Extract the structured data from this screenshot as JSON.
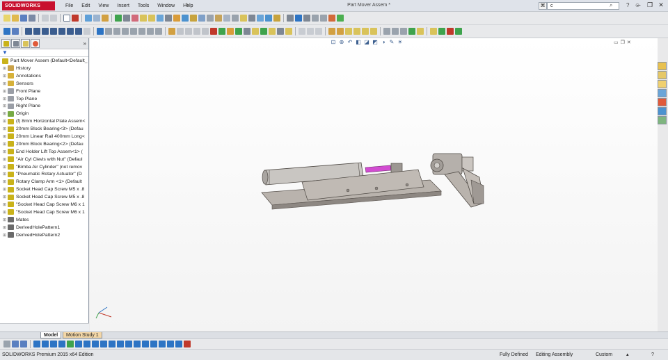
{
  "app": {
    "logo_text": "SOLIDWORKS",
    "document_title": "Part Mover Assem *"
  },
  "menu": [
    "File",
    "Edit",
    "View",
    "Insert",
    "Tools",
    "Window",
    "Help"
  ],
  "search": {
    "value": "c"
  },
  "feature_tree": {
    "filter": "▼",
    "root": "Part Mover Assem  (Default<Default_",
    "items": [
      {
        "label": "History",
        "icon": "history-icon",
        "color": "#caa24a"
      },
      {
        "label": "Annotations",
        "icon": "annotations-icon",
        "color": "#d6b13a"
      },
      {
        "label": "Sensors",
        "icon": "sensors-icon",
        "color": "#d6b13a"
      },
      {
        "label": "Front Plane",
        "icon": "plane-icon",
        "color": "#9a9ea6"
      },
      {
        "label": "Top Plane",
        "icon": "plane-icon",
        "color": "#9a9ea6"
      },
      {
        "label": "Right Plane",
        "icon": "plane-icon",
        "color": "#9a9ea6"
      },
      {
        "label": "Origin",
        "icon": "origin-icon",
        "color": "#7a4"
      },
      {
        "label": "(f) 8mm Horizontal Plate Assem<",
        "icon": "subassembly-icon",
        "color": "#c9b21a"
      },
      {
        "label": "20mm Block Bearing<3> (Defau",
        "icon": "subassembly-icon",
        "color": "#c9b21a"
      },
      {
        "label": "20mm Linear Rail 400mm Long<",
        "icon": "subassembly-icon",
        "color": "#c9b21a"
      },
      {
        "label": "20mm Block Bearing<2> (Defau",
        "icon": "subassembly-icon",
        "color": "#c9b21a"
      },
      {
        "label": "End Holder Lift Top Assem<1> (",
        "icon": "subassembly-icon",
        "color": "#c9b21a"
      },
      {
        "label": "\"Air Cyl Clevis with Nut\" (Defaul",
        "icon": "subassembly-icon",
        "color": "#c9b21a"
      },
      {
        "label": "\"Bimba Air Cylinder\" (not remov",
        "icon": "part-icon",
        "color": "#c9b21a"
      },
      {
        "label": "\"Pneumatic Rotary Actuator\" (D",
        "icon": "subassembly-icon",
        "color": "#c9b21a"
      },
      {
        "label": "Rotary Clamp Arm <1> (Default",
        "icon": "subassembly-icon",
        "color": "#c9b21a"
      },
      {
        "label": "Socket Head Cap Screw M5 x .8",
        "icon": "subassembly-icon",
        "color": "#c9b21a"
      },
      {
        "label": "Socket Head Cap Screw M5 x .8",
        "icon": "subassembly-icon",
        "color": "#c9b21a"
      },
      {
        "label": "\"Socket Head Cap Screw M6 x 1",
        "icon": "subassembly-icon",
        "color": "#c9b21a"
      },
      {
        "label": "\"Socket Head Cap Screw M6 x 1",
        "icon": "subassembly-icon",
        "color": "#c9b21a"
      },
      {
        "label": "Mates",
        "icon": "mates-icon",
        "color": "#6a6a6a"
      },
      {
        "label": "DerivedHolePattern1",
        "icon": "pattern-icon",
        "color": "#6a6a6a"
      },
      {
        "label": "DerivedHolePattern2",
        "icon": "pattern-icon",
        "color": "#6a6a6a"
      }
    ]
  },
  "bottom_tabs": {
    "model": "Model",
    "motion": "Motion Study 1"
  },
  "status": {
    "product": "SOLIDWORKS Premium 2015 x64 Edition",
    "defined": "Fully Defined",
    "mode": "Editing Assembly",
    "units": "Custom"
  }
}
